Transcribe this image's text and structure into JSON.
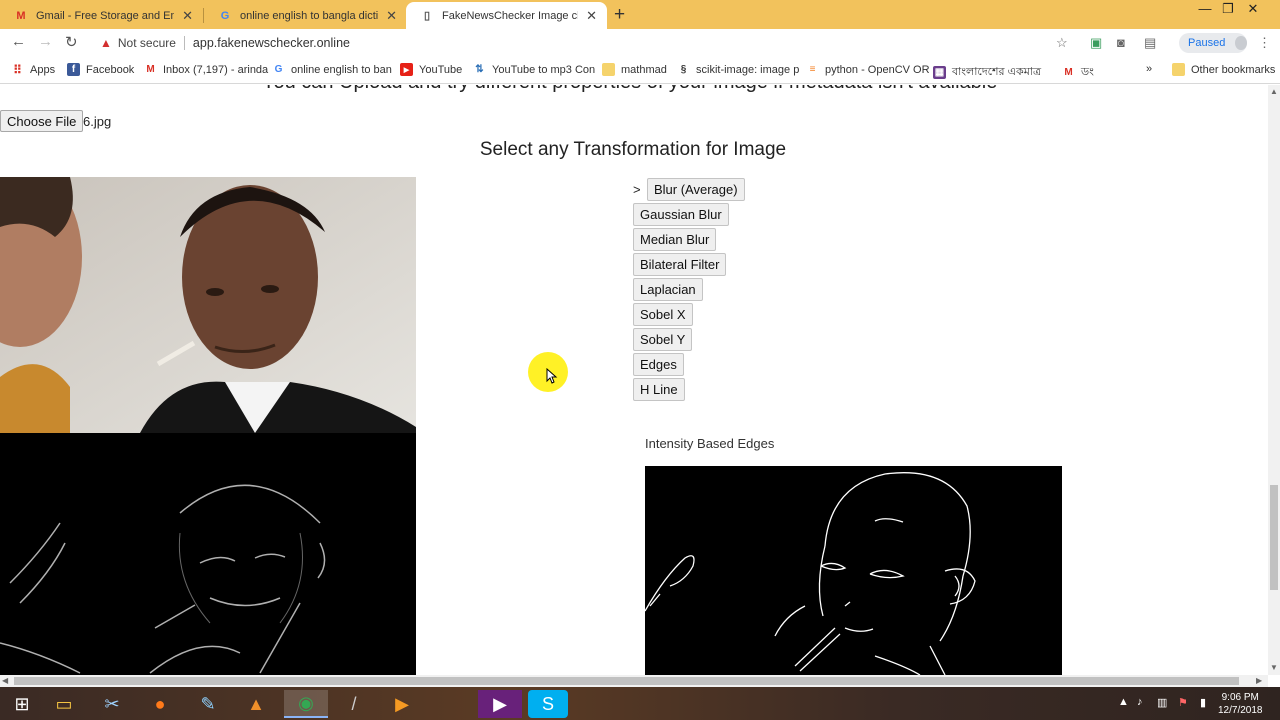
{
  "tabs": [
    {
      "title": "Gmail - Free Storage and Email fr",
      "icon": "gmail-icon",
      "active": false
    },
    {
      "title": "online english to bangla dictiona",
      "icon": "google-icon",
      "active": false
    },
    {
      "title": "FakeNewsChecker Image checkin",
      "icon": "page-icon",
      "active": true
    }
  ],
  "address": {
    "security": "Not secure",
    "url": "app.fakenewschecker.online"
  },
  "profile": {
    "status": "Paused"
  },
  "bookmarks": [
    {
      "label": "Apps",
      "icon": "apps-grid-icon"
    },
    {
      "label": "Facebook",
      "icon": "facebook-icon"
    },
    {
      "label": "Inbox (7,197) - arinda",
      "icon": "gmail-icon"
    },
    {
      "label": "online english to ban",
      "icon": "google-icon"
    },
    {
      "label": "YouTube",
      "icon": "youtube-icon"
    },
    {
      "label": "YouTube to mp3 Con",
      "icon": "converter-icon"
    },
    {
      "label": "mathmad",
      "icon": "folder-icon"
    },
    {
      "label": "scikit-image: image p",
      "icon": "scikit-icon"
    },
    {
      "label": "python - OpenCV OR",
      "icon": "stackoverflow-icon"
    },
    {
      "label": "বাংলাদেশের একমাত্র",
      "icon": "site-icon"
    },
    {
      "label": "ডং",
      "icon": "gmail-icon"
    }
  ],
  "bookmarks_more": "»",
  "other_bookmarks": "Other bookmarks",
  "page": {
    "cut_heading": "You can Upload and try different properties of your image if metadata isn't available",
    "choose_file_label": "Choose File",
    "file_name": "6.jpg",
    "section_title": "Select any Transformation for Image",
    "selected_marker": ">",
    "transforms": [
      "Blur (Average)",
      "Gaussian Blur",
      "Median Blur",
      "Bilateral Filter",
      "Laplacian",
      "Sobel X",
      "Sobel Y",
      "Edges",
      "H Line"
    ],
    "edges_caption": "Intensity Based Edges"
  },
  "taskbar": {
    "apps": [
      "windows-start-icon",
      "file-explorer-icon",
      "snipping-tool-icon",
      "firefox-icon",
      "paint-icon",
      "matlab-icon",
      "chrome-icon",
      "pen-icon",
      "media-player-icon",
      "visual-studio-icon",
      "skype-icon"
    ],
    "time": "9:06 PM",
    "date": "12/7/2018"
  },
  "colors": {
    "tab_strip": "#f2c25c",
    "accent_link": "#1a73e8",
    "cursor_highlight": "#ffee00"
  }
}
